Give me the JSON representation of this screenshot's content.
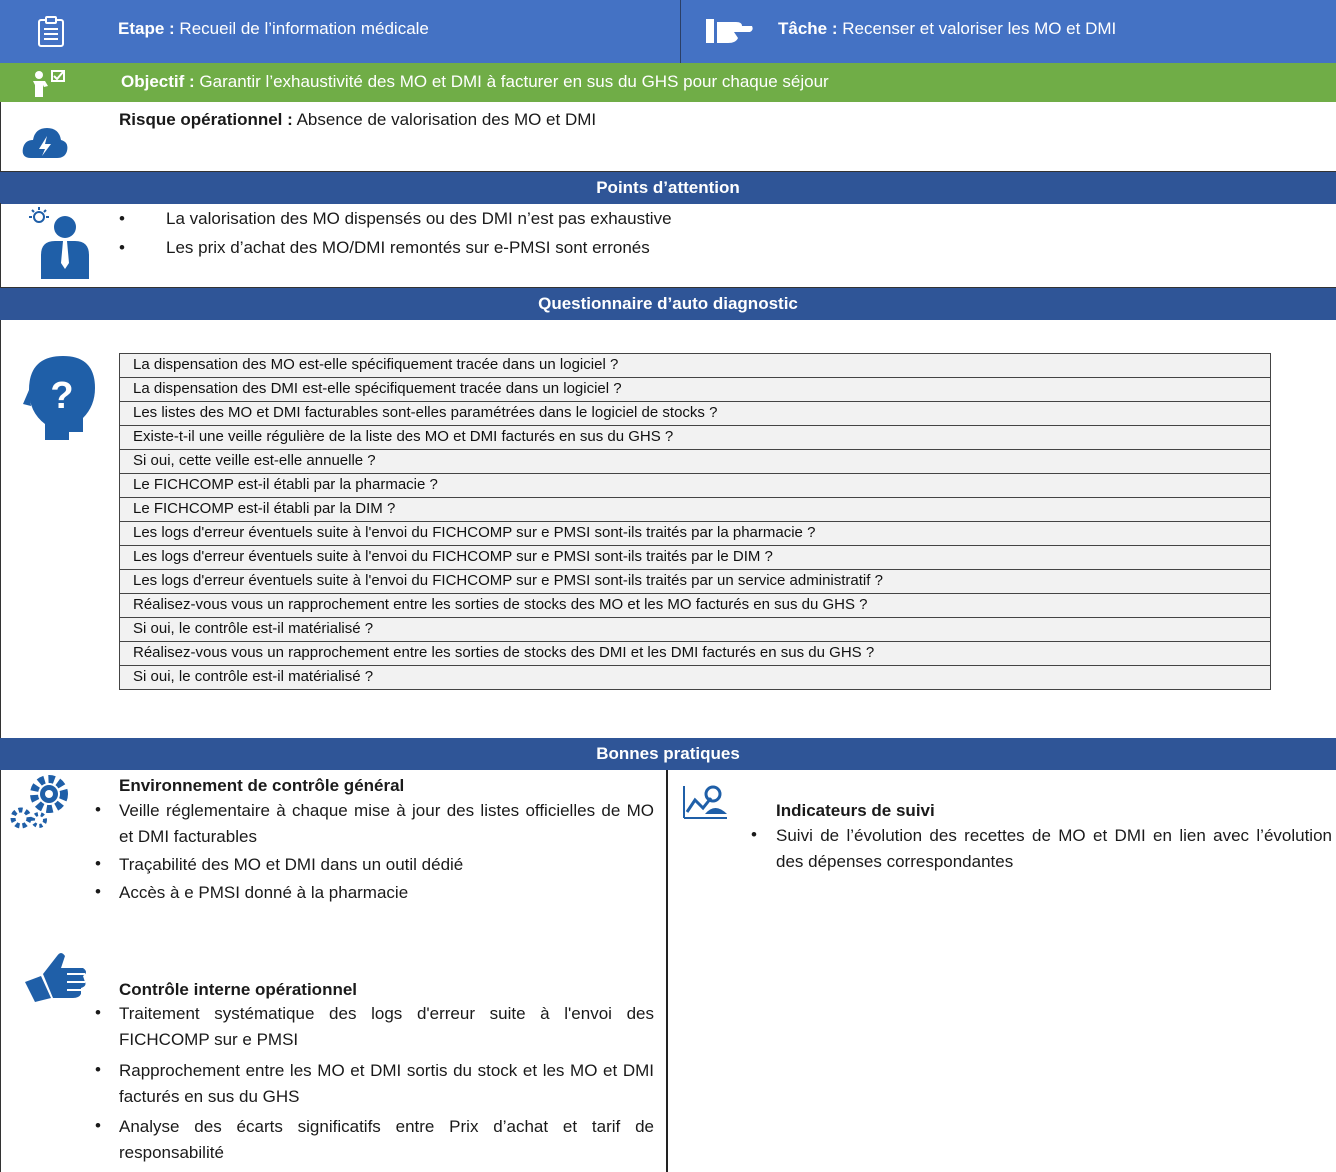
{
  "header": {
    "etape_label": "Etape :",
    "etape_value": "Recueil de l’information médicale",
    "tache_label": "Tâche :",
    "tache_value": "Recenser et valoriser les MO et DMI",
    "objectif_label": "Objectif :",
    "objectif_value": "Garantir l’exhaustivité des MO et DMI à facturer en sus du GHS pour chaque séjour",
    "risque_label": "Risque opérationnel :",
    "risque_value": "Absence de valorisation des MO et DMI"
  },
  "points_attention": {
    "title": "Points d’attention",
    "items": [
      "La valorisation des MO dispensés ou des DMI n’est pas exhaustive",
      "Les  prix d’achat des MO/DMI remontés sur e-PMSI sont erronés"
    ]
  },
  "questionnaire": {
    "title": "Questionnaire d’auto diagnostic",
    "questions": [
      "La dispensation des MO est-elle spécifiquement tracée dans un logiciel ?",
      "La dispensation des DMI est-elle spécifiquement tracée dans un logiciel ?",
      "Les listes des MO et DMI facturables sont-elles paramétrées dans le logiciel de stocks ?",
      "Existe-t-il une veille régulière de la liste des MO et DMI facturés en sus du GHS ?",
      "Si oui, cette veille est-elle annuelle ?",
      "Le FICHCOMP est-il établi par la pharmacie ?",
      "Le FICHCOMP est-il établi par la DIM ?",
      "Les logs d'erreur éventuels suite à l'envoi du FICHCOMP sur e PMSI sont-ils traités par la pharmacie ?",
      "Les logs d'erreur éventuels suite à l'envoi du FICHCOMP sur e PMSI sont-ils traités par le DIM ?",
      "Les logs d'erreur éventuels suite à l'envoi du FICHCOMP sur e PMSI sont-ils traités par un service administratif ?",
      "Réalisez-vous vous un rapprochement entre les sorties de stocks des MO et les MO facturés en sus du GHS ?",
      "Si oui, le contrôle est-il matérialisé ?",
      "Réalisez-vous vous un rapprochement entre les sorties de stocks des DMI et les DMI facturés en sus du GHS ?",
      "Si oui, le contrôle est-il matérialisé ?"
    ]
  },
  "bonnes_pratiques": {
    "title": "Bonnes pratiques",
    "env_title": "Environnement de contrôle général",
    "env_items": [
      "Veille réglementaire à chaque mise à jour des listes officielles de MO et DMI facturables",
      "Traçabilité des MO et DMI dans un outil dédié",
      "Accès à e PMSI donné à la pharmacie"
    ],
    "ci_title": "Contrôle interne opérationnel",
    "ci_items": [
      "Traitement systématique des logs d'erreur suite à l'envoi des FICHCOMP sur e PMSI",
      "Rapprochement entre les MO et DMI sortis du stock et les MO et DMI facturés en sus du GHS",
      "Analyse des écarts significatifs entre Prix d’achat et tarif de responsabilité"
    ],
    "ind_title": "Indicateurs de suivi",
    "ind_items": [
      "Suivi de l’évolution des recettes de MO et DMI en lien avec l’évolution des dépenses correspondantes"
    ]
  },
  "bullet_char": "•",
  "colors": {
    "header_blue": "#4472c4",
    "objective_green": "#70ad47",
    "section_navy": "#2f5597",
    "icon_blue": "#1f5fa8"
  }
}
